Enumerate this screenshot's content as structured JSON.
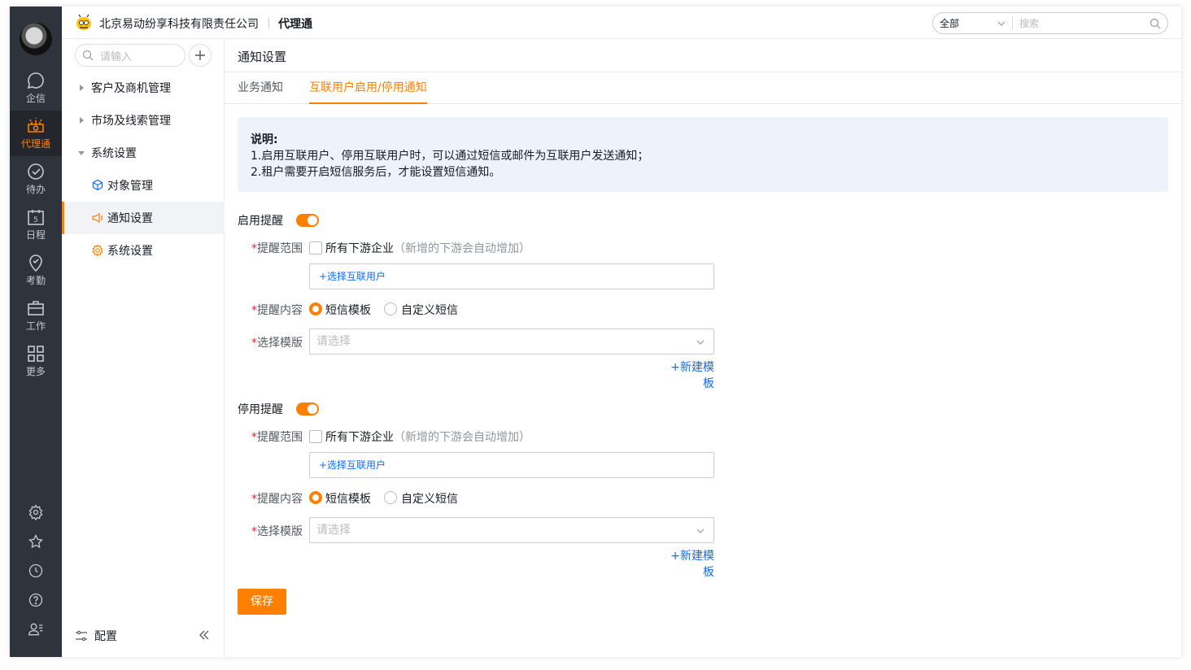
{
  "colors": {
    "accent": "#ff8000",
    "link": "#0c6cff",
    "nav_bg": "#2f333b"
  },
  "nav": {
    "items": [
      {
        "label": "企信",
        "icon": "chat-icon"
      },
      {
        "label": "代理通",
        "icon": "agent-icon",
        "active": true
      },
      {
        "label": "待办",
        "icon": "check-circle-icon"
      },
      {
        "label": "日程",
        "icon": "calendar-icon",
        "badge": "5"
      },
      {
        "label": "考勤",
        "icon": "location-check-icon"
      },
      {
        "label": "工作",
        "icon": "briefcase-icon"
      },
      {
        "label": "更多",
        "icon": "grid-icon"
      }
    ],
    "bottom_icons": [
      "gear-icon",
      "star-icon",
      "clock-icon",
      "help-icon",
      "user-list-icon"
    ]
  },
  "header": {
    "company": "北京易动纷享科技有限责任公司",
    "product": "代理通",
    "search_scope": "全部",
    "search_placeholder": "搜索"
  },
  "sidebar": {
    "search_placeholder": "请输入",
    "groups": [
      {
        "label": "客户及商机管理"
      },
      {
        "label": "市场及线索管理"
      },
      {
        "label": "系统设置"
      }
    ],
    "subitems": [
      {
        "label": "对象管理"
      },
      {
        "label": "通知设置",
        "active": true
      },
      {
        "label": "系统设置"
      }
    ],
    "config_label": "配置"
  },
  "main": {
    "title": "通知设置",
    "tabs": [
      {
        "label": "业务通知"
      },
      {
        "label": "互联用户启用/停用通知",
        "active": true
      }
    ],
    "notice": {
      "title": "说明:",
      "line1": "1.启用互联用户、停用互联用户时，可以通过短信或邮件为互联用户发送通知；",
      "line2": "2.租户需要开启短信服务后，才能设置短信通知。"
    },
    "sections": [
      {
        "title": "启用提醒",
        "enabled": true,
        "scope_label": "提醒范围",
        "scope_checkbox": "所有下游企业",
        "scope_hint": "（新增的下游会自动增加）",
        "select_user": "+选择互联用户",
        "content_label": "提醒内容",
        "option_template": "短信模板",
        "option_custom": "自定义短信",
        "template_label": "选择模版",
        "template_placeholder": "请选择",
        "new_template": "+新建模板"
      },
      {
        "title": "停用提醒",
        "enabled": true,
        "scope_label": "提醒范围",
        "scope_checkbox": "所有下游企业",
        "scope_hint": "（新增的下游会自动增加）",
        "select_user": "+选择互联用户",
        "content_label": "提醒内容",
        "option_template": "短信模板",
        "option_custom": "自定义短信",
        "template_label": "选择模版",
        "template_placeholder": "请选择",
        "new_template": "+新建模板"
      }
    ],
    "save_label": "保存"
  }
}
